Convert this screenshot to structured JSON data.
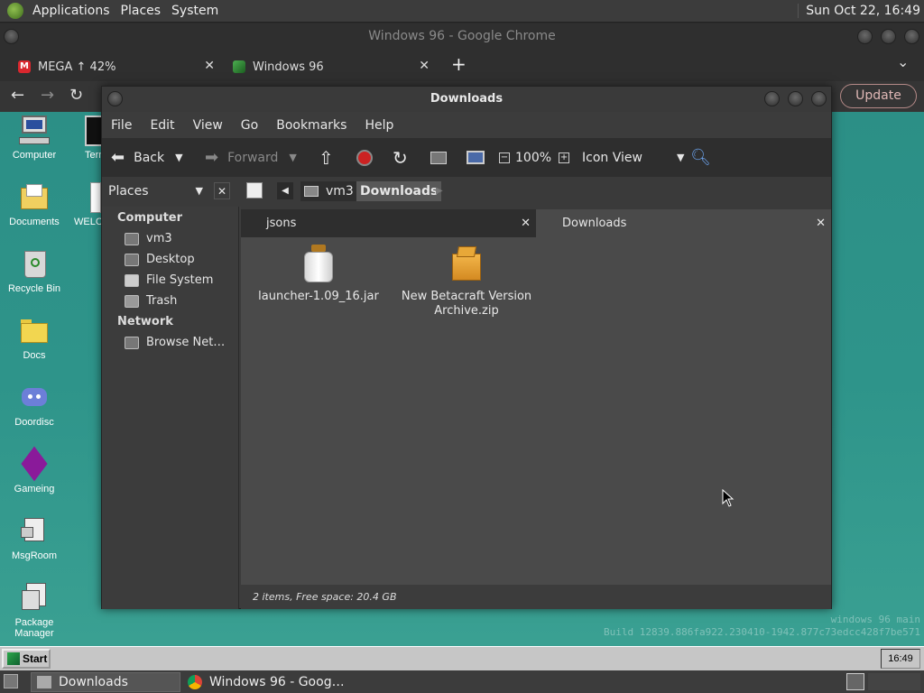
{
  "top_panel": {
    "menus": [
      "Applications",
      "Places",
      "System"
    ],
    "clock": "Sun Oct 22, 16:49"
  },
  "chrome": {
    "window_title": "Windows 96 - Google Chrome",
    "tabs": [
      {
        "label": "MEGA ↑ 42%",
        "close": "✕"
      },
      {
        "label": "Windows 96",
        "close": "✕"
      }
    ],
    "new_tab": "+",
    "tab_menu": "⌄",
    "back": "←",
    "forward": "→",
    "reload": "↻",
    "update_label": "Update",
    "more": "⋮"
  },
  "desktop": {
    "icons": [
      {
        "label": "Computer",
        "icon": "computer-icon"
      },
      {
        "label": "Term",
        "icon": "terminal-icon"
      },
      {
        "label": "Documents",
        "icon": "documents-folder-icon"
      },
      {
        "label": "WELC",
        "icon": "welcome-icon"
      },
      {
        "label": "Recycle Bin",
        "icon": "recycle-bin-icon"
      },
      {
        "label": "Docs",
        "icon": "folder-icon"
      },
      {
        "label": "Doordisc",
        "icon": "discord-icon"
      },
      {
        "label": "Gameing",
        "icon": "game-cube-icon"
      },
      {
        "label": "MsgRoom",
        "icon": "msgroom-icon"
      },
      {
        "label": "Package Manager",
        "icon": "package-manager-icon"
      }
    ],
    "build_line1": "windows 96 main",
    "build_line2": "Build 12839.886fa922.230410-1942.877c73edcc428f7be571"
  },
  "nautilus": {
    "title": "Downloads",
    "menu": [
      "File",
      "Edit",
      "View",
      "Go",
      "Bookmarks",
      "Help"
    ],
    "toolbar": {
      "back": "Back",
      "forward": "Forward",
      "zoom": "100%",
      "view_mode": "Icon View"
    },
    "places_label": "Places",
    "path": [
      "vm3",
      "Downloads"
    ],
    "sidebar": {
      "computer_heading": "Computer",
      "computer_items": [
        "vm3",
        "Desktop",
        "File System",
        "Trash"
      ],
      "network_heading": "Network",
      "network_items": [
        "Browse Net…"
      ]
    },
    "tabs": [
      "jsons",
      "Downloads"
    ],
    "files": [
      {
        "name": "launcher-1.09_16.jar",
        "icon": "jar-icon"
      },
      {
        "name_line1": "New Betacraft Version",
        "name_line2": "Archive.zip",
        "icon": "zip-archive-icon"
      }
    ],
    "status": "2 items, Free space: 20.4 GB"
  },
  "win96_taskbar": {
    "start_label": "Start",
    "clock": "16:49"
  },
  "bottom_panel": {
    "tasks": [
      "Downloads",
      "Windows 96 - Goog…"
    ]
  },
  "colors": {
    "desktop_teal": "#2e948a",
    "panel_dark": "#3c3c3c",
    "update_accent": "#e0b8b6"
  }
}
